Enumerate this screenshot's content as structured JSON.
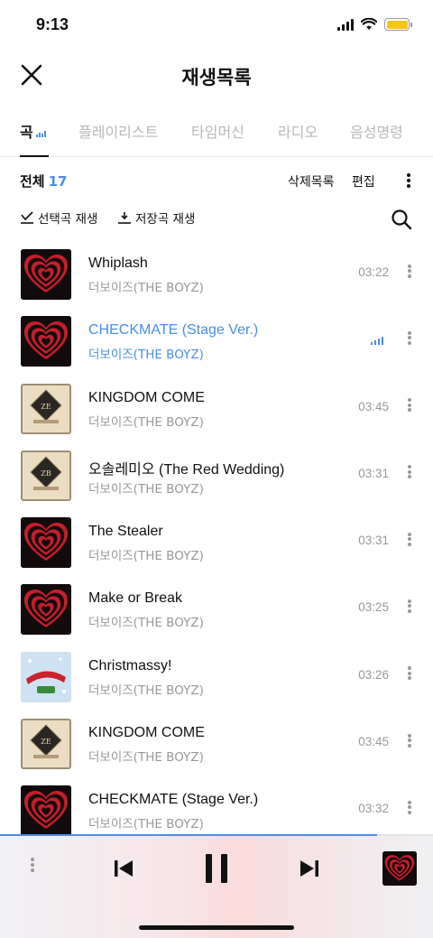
{
  "status_bar": {
    "time": "9:13",
    "battery_color": "#f5c518"
  },
  "header": {
    "title": "재생목록",
    "close_icon": "close-icon"
  },
  "tabs": [
    {
      "label": "곡",
      "active": true
    },
    {
      "label": "플레이리스트",
      "active": false
    },
    {
      "label": "타임머신",
      "active": false
    },
    {
      "label": "라디오",
      "active": false
    },
    {
      "label": "음성명령",
      "active": false
    }
  ],
  "summary": {
    "total_label": "전체",
    "total_count": "17",
    "delete_label": "삭제목록",
    "edit_label": "편집"
  },
  "actions": {
    "play_selected": "선택곡 재생",
    "play_saved": "저장곡 재생"
  },
  "songs": [
    {
      "title": "Whiplash",
      "artist": "더보이즈(THE BOYZ)",
      "duration": "03:22",
      "art": "heart",
      "playing": false
    },
    {
      "title": "CHECKMATE (Stage Ver.)",
      "artist": "더보이즈(THE BOYZ)",
      "duration": "",
      "art": "heart",
      "playing": true
    },
    {
      "title": "KINGDOM COME",
      "artist": "더보이즈(THE BOYZ)",
      "duration": "03:45",
      "art": "kingdom",
      "playing": false
    },
    {
      "title": "오솔레미오 (The Red Wedding)",
      "artist": "더보이즈(THE BOYZ)",
      "duration": "03:31",
      "art": "reborn",
      "playing": false
    },
    {
      "title": "The Stealer",
      "artist": "더보이즈(THE BOYZ)",
      "duration": "03:31",
      "art": "heart",
      "playing": false
    },
    {
      "title": "Make or Break",
      "artist": "더보이즈(THE BOYZ)",
      "duration": "03:25",
      "art": "heart",
      "playing": false
    },
    {
      "title": "Christmassy!",
      "artist": "더보이즈(THE BOYZ)",
      "duration": "03:26",
      "art": "christmas",
      "playing": false
    },
    {
      "title": "KINGDOM COME",
      "artist": "더보이즈(THE BOYZ)",
      "duration": "03:45",
      "art": "kingdom",
      "playing": false
    },
    {
      "title": "CHECKMATE (Stage Ver.)",
      "artist": "더보이즈(THE BOYZ)",
      "duration": "03:32",
      "art": "heart",
      "playing": false
    }
  ],
  "player": {
    "progress": 0.87,
    "accent": "#4a8ee6"
  }
}
